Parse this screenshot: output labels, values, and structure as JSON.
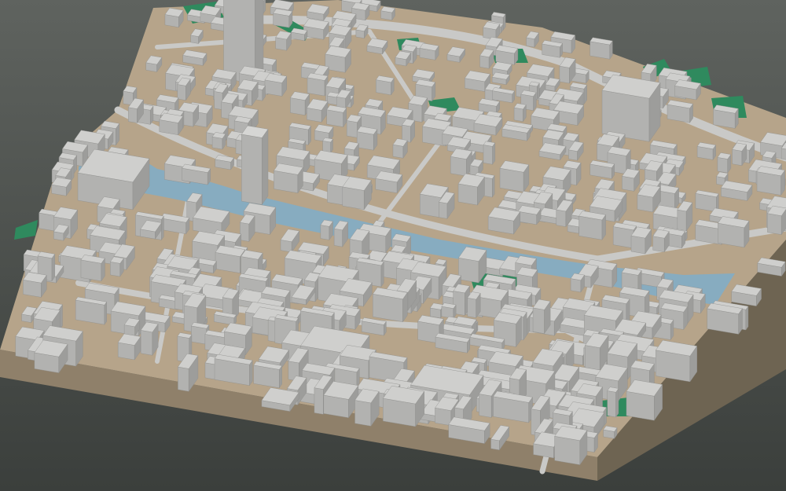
{
  "scene": {
    "kind": "3d-city-block-model",
    "view": "oblique-aerial",
    "features": [
      "river",
      "buildings",
      "parks",
      "roads",
      "terrain-base"
    ]
  },
  "colors": {
    "background_top": "#5f635f",
    "background_bottom": "#3b3f3c",
    "base_side": "#8f806a",
    "base_side_dark": "#6e6452",
    "ground": "#b6a48a",
    "road": "#c9c9c7",
    "river": "#87acc0",
    "park": "#2f8a5e",
    "building_top": "#cfcfcd",
    "building_left": "#b2b2b0",
    "building_right": "#9d9d9b",
    "tower_top": "#d6d6d4"
  }
}
